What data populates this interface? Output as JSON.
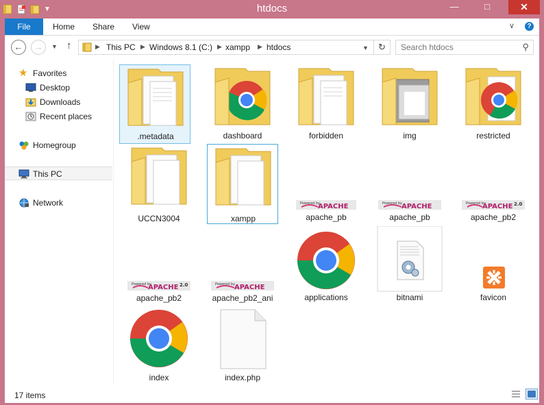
{
  "window": {
    "title": "htdocs"
  },
  "ribbon": {
    "file": "File",
    "home": "Home",
    "share": "Share",
    "view": "View"
  },
  "address": {
    "crumbs": [
      "This PC",
      "Windows 8.1 (C:)",
      "xampp",
      "htdocs"
    ]
  },
  "search": {
    "placeholder": "Search htdocs"
  },
  "nav": {
    "favorites": "Favorites",
    "desktop": "Desktop",
    "downloads": "Downloads",
    "recent": "Recent places",
    "homegroup": "Homegroup",
    "thispc": "This PC",
    "network": "Network"
  },
  "items": [
    {
      "name": ".metadata",
      "kind": "folder-docs"
    },
    {
      "name": "dashboard",
      "kind": "folder-chrome"
    },
    {
      "name": "forbidden",
      "kind": "folder-docs"
    },
    {
      "name": "img",
      "kind": "folder-gray"
    },
    {
      "name": "restricted",
      "kind": "folder-chrome"
    },
    {
      "name": "UCCN3004",
      "kind": "folder-docs"
    },
    {
      "name": "xampp",
      "kind": "folder-docs"
    },
    {
      "name": "apache_pb",
      "kind": "apache-banner"
    },
    {
      "name": "apache_pb",
      "kind": "apache-banner"
    },
    {
      "name": "apache_pb2",
      "kind": "apache-banner-2"
    },
    {
      "name": "applications",
      "kind": "chrome"
    },
    {
      "name": "bitnami",
      "kind": "config-file"
    },
    {
      "name": "favicon",
      "kind": "xampp-icon"
    },
    {
      "name": "apache_pb2",
      "kind": "apache-banner-2"
    },
    {
      "name": "apache_pb2_ani",
      "kind": "apache-banner"
    },
    {
      "name": "index",
      "kind": "chrome"
    },
    {
      "name": "index.php",
      "kind": "blank-file"
    }
  ],
  "status": {
    "count": "17 items"
  },
  "colors": {
    "titlebar": "#c8768a",
    "file_tab": "#1979ca",
    "close": "#c7372f",
    "selection": "#e5f3fb"
  }
}
